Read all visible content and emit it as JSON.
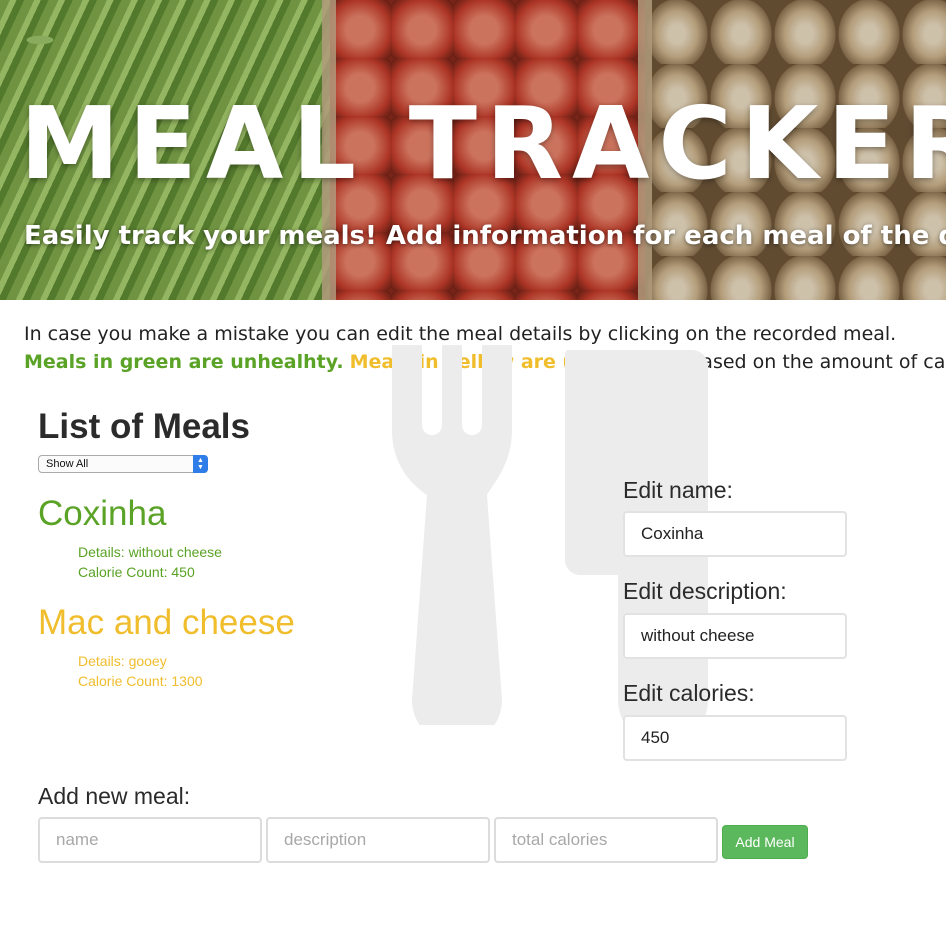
{
  "hero": {
    "title": "MEAL TRACKER",
    "subtitle": "Easily track your meals! Add information for each meal of the day."
  },
  "instructions": {
    "line1": "In case you make a mistake you can edit the meal details by clicking on the recorded meal.",
    "green_note": "Meals in green are unhealhty.",
    "yellow_note": "Meals in yellow are unhealhty.",
    "rest": " (based on the amount of calories)"
  },
  "list": {
    "title": "List of Meals",
    "filter_selected": "Show All",
    "meals": [
      {
        "name": "Coxinha",
        "details": "Details: without cheese",
        "calories": "Calorie Count: 450",
        "color": "#5aa326"
      },
      {
        "name": "Mac and cheese",
        "details": "Details: gooey",
        "calories": "Calorie Count: 1300",
        "color": "#f0bd2c"
      }
    ]
  },
  "edit": {
    "name_label": "Edit name:",
    "name_value": "Coxinha",
    "description_label": "Edit description:",
    "description_value": "without cheese",
    "calories_label": "Edit calories:",
    "calories_value": "450"
  },
  "add": {
    "label": "Add new meal:",
    "name_placeholder": "name",
    "description_placeholder": "description",
    "calories_placeholder": "total calories",
    "button_label": "Add Meal"
  },
  "colors": {
    "healthy_green": "#5aa326",
    "unhealthy_yellow": "#f0bd2c",
    "button_green": "#5cb85c"
  },
  "icons": [
    "cutlery-icon",
    "select-arrows-icon"
  ]
}
